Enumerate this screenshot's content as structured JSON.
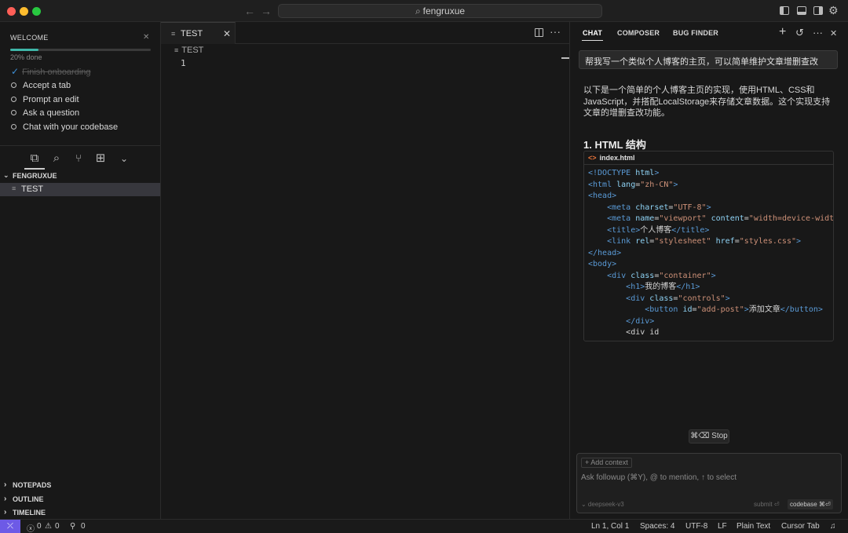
{
  "titlebar": {
    "workspace": "fengruxue"
  },
  "welcome": {
    "title": "WELCOME",
    "progress_fraction": 0.2,
    "progress_text": "20% done",
    "items": [
      {
        "label": "Finish onboarding",
        "done": true
      },
      {
        "label": "Accept a tab",
        "done": false
      },
      {
        "label": "Prompt an edit",
        "done": false
      },
      {
        "label": "Ask a question",
        "done": false
      },
      {
        "label": "Chat with your codebase",
        "done": false
      }
    ]
  },
  "explorer": {
    "folder": "FENGRUXUE",
    "file": "TEST"
  },
  "sections": {
    "notepads": "NOTEPADS",
    "outline": "OUTLINE",
    "timeline": "TIMELINE"
  },
  "editor": {
    "tab_label": "TEST",
    "breadcrumb": "TEST",
    "line_number": "1"
  },
  "chat": {
    "tabs": [
      "CHAT",
      "COMPOSER",
      "BUG FINDER"
    ],
    "prompt": "帮我写一个类似个人博客的主页，可以简单维护文章增删查改",
    "reply": "以下是一个简单的个人博客主页的实现，使用HTML、CSS和JavaScript，并搭配LocalStorage来存储文章数据。这个实现支持文章的增删查改功能。",
    "section_heading": "1. HTML 结构",
    "code_filename": "index.html",
    "stop_label": "⌘⌫ Stop",
    "add_context": "+ Add context",
    "followup_placeholder": "Ask followup (⌘Y), @ to mention, ↑ to select",
    "model": "⌄ deepseek-v3",
    "submit_label": "submit ⏎",
    "codebase_label": "codebase ⌘⏎"
  },
  "statusbar": {
    "errors": "0",
    "warnings": "0",
    "ports": "0",
    "position": "Ln 1, Col 1",
    "spaces": "Spaces: 4",
    "encoding": "UTF-8",
    "eol": "LF",
    "language": "Plain Text",
    "tab_mode": "Cursor Tab"
  },
  "colors": {
    "accent": "#6d5ae6",
    "progress": "#3fb6a8",
    "check": "#3d8fd6"
  }
}
